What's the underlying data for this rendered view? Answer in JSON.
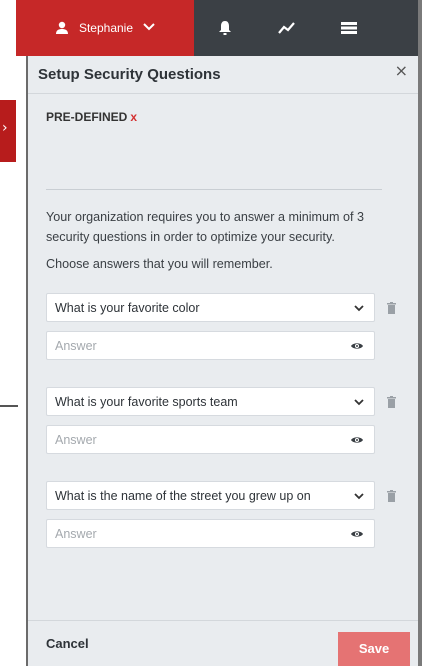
{
  "topbar": {
    "user_name": "Stephanie",
    "colors": {
      "bar": "#3b4045",
      "user_tab": "#c62828"
    },
    "icons": [
      "person-icon",
      "chevron-down-icon",
      "bell-icon",
      "activity-icon",
      "list-icon"
    ]
  },
  "modal": {
    "title": "Setup Security Questions",
    "close_icon": "close-icon",
    "predefined_label": "PRE-DEFINED",
    "predefined_x": "x",
    "description": "Your organization requires you to answer a minimum of 3 security questions in order to optimize your security.",
    "instruction": "Choose answers that you will remember.",
    "questions": [
      {
        "question": "What is your favorite color",
        "answer_placeholder": "Answer"
      },
      {
        "question": "What is your favorite sports team",
        "answer_placeholder": "Answer"
      },
      {
        "question": "What is the name of the street you grew up on",
        "answer_placeholder": "Answer"
      }
    ],
    "footer": {
      "cancel_label": "Cancel",
      "save_label": "Save",
      "save_color": "#e57373"
    }
  }
}
